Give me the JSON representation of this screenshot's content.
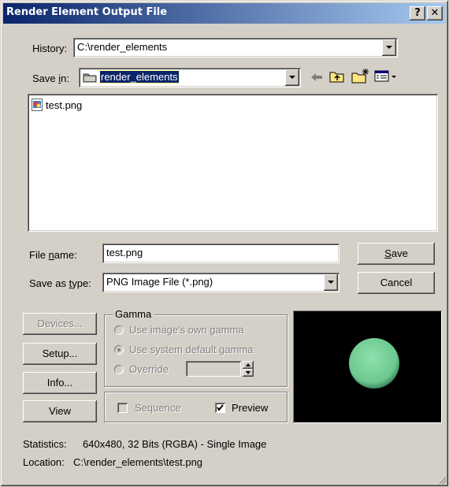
{
  "window": {
    "title": "Render Element Output File",
    "help_btn": "?",
    "close_btn": "✕"
  },
  "history": {
    "label": "History:",
    "value": "C:\\render_elements"
  },
  "save_in": {
    "label_pre": "Save ",
    "label_ul": "i",
    "label_post": "n:",
    "value": "render_elements"
  },
  "file_list": [
    {
      "name": "test.png"
    }
  ],
  "file_name": {
    "label_pre": "File ",
    "label_ul": "n",
    "label_post": "ame:",
    "value": "test.png"
  },
  "save_type": {
    "label_pre": "Save as ",
    "label_ul": "t",
    "label_post": "ype:",
    "value": "PNG Image File (*.png)"
  },
  "buttons": {
    "save_ul": "S",
    "save_rest": "ave",
    "cancel": "Cancel",
    "devices": "Devices...",
    "setup": "Setup...",
    "info": "Info...",
    "view": "View"
  },
  "gamma": {
    "title": "Gamma",
    "own": "Use image's own gamma",
    "system": "Use system default gamma",
    "override": "Override",
    "override_value": ""
  },
  "options": {
    "sequence": "Sequence",
    "preview": "Preview",
    "preview_checked": true
  },
  "preview_colors": {
    "background": "#000000",
    "sphere": "#7fd49c"
  },
  "status": {
    "statistics_label": "Statistics:",
    "statistics_value": "640x480, 32 Bits (RGBA) - Single Image",
    "location_label": "Location:",
    "location_value": "C:\\render_elements\\test.png"
  }
}
